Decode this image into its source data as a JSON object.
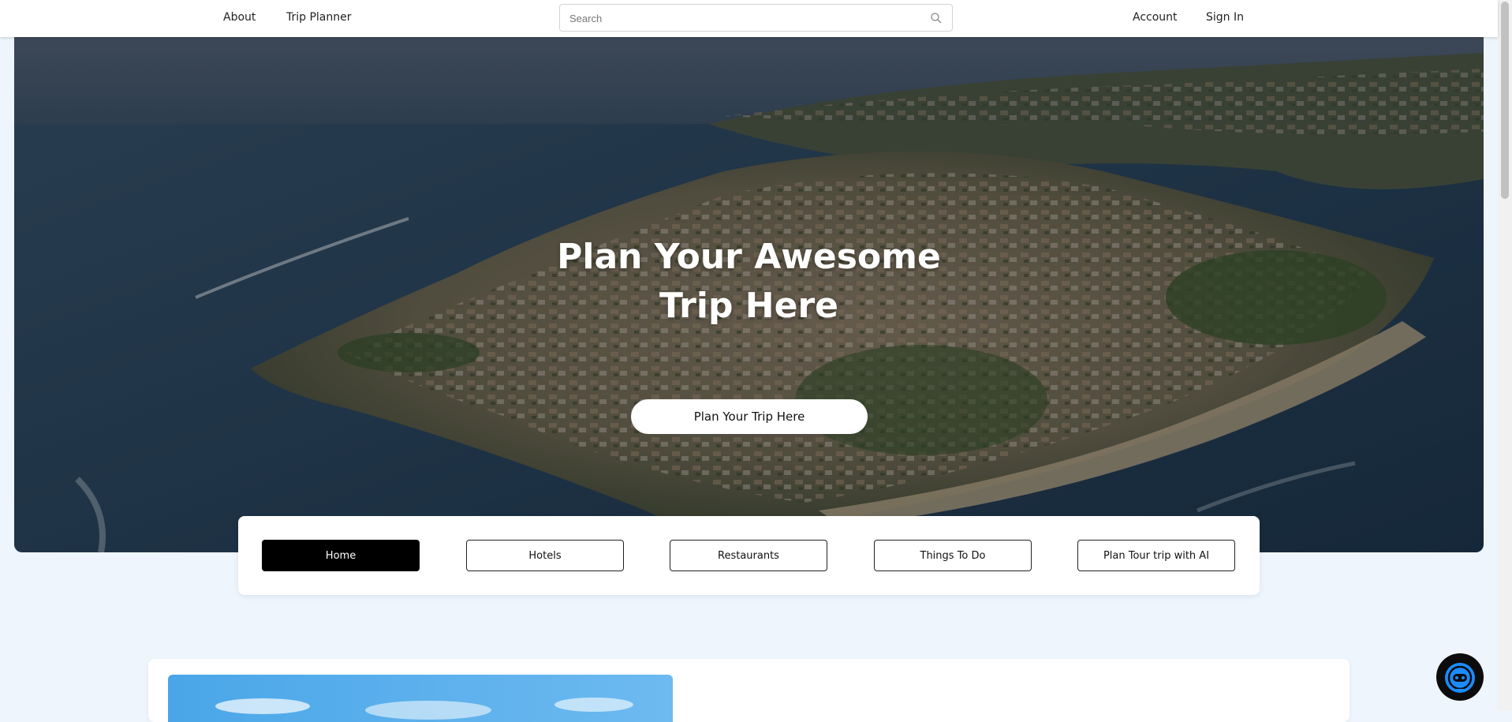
{
  "nav": {
    "about": "About",
    "trip_planner": "Trip Planner",
    "account": "Account",
    "sign_in": "Sign In"
  },
  "search": {
    "placeholder": "Search",
    "icon": "search-icon"
  },
  "hero": {
    "title_line1": "Plan Your Awesome",
    "title_line2": "Trip Here",
    "cta": "Plan Your Trip Here"
  },
  "tabs": [
    {
      "label": "Home",
      "active": true
    },
    {
      "label": "Hotels",
      "active": false
    },
    {
      "label": "Restaurants",
      "active": false
    },
    {
      "label": "Things To Do",
      "active": false
    },
    {
      "label": "Plan Tour trip with AI",
      "active": false
    }
  ],
  "chatbot": {
    "icon": "robot-icon",
    "accent": "#1a8cff"
  },
  "colors": {
    "page_bg": "#eef5fd",
    "active_tab": "#000000",
    "nav_bg": "#ffffff"
  }
}
